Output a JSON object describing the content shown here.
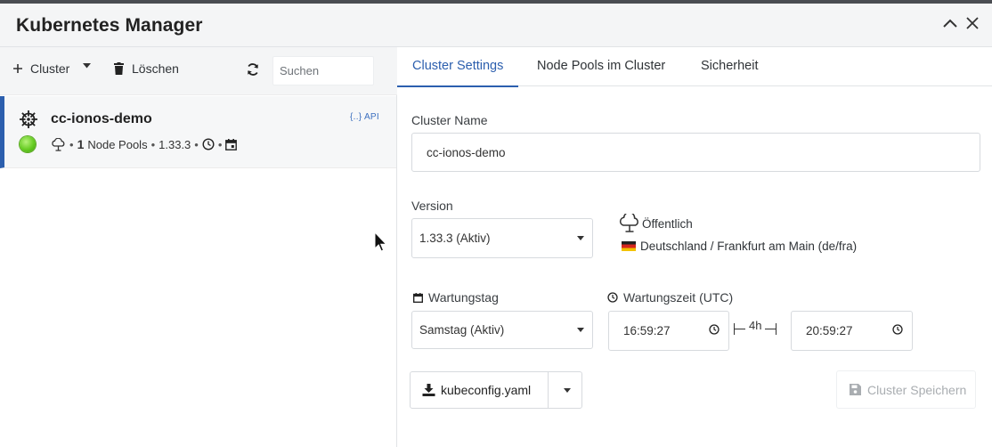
{
  "window": {
    "title": "Kubernetes Manager"
  },
  "toolbar": {
    "add_label": "Cluster",
    "delete_label": "Löschen",
    "search_placeholder": "Suchen"
  },
  "clusters": [
    {
      "name": "cc-ionos-demo",
      "api_badge": "{..} API",
      "status_color": "#66cc22",
      "node_pool_count": "1",
      "node_pools_label": "Node Pools",
      "version": "1.33.3"
    }
  ],
  "tabs": [
    {
      "label": "Cluster Settings",
      "active": true
    },
    {
      "label": "Node Pools im Cluster",
      "active": false
    },
    {
      "label": "Sicherheit",
      "active": false
    }
  ],
  "settings": {
    "cluster_name_label": "Cluster Name",
    "cluster_name_value": "cc-ionos-demo",
    "version_label": "Version",
    "version_value": "1.33.3 (Aktiv)",
    "visibility": "Öffentlich",
    "region": "Deutschland / Frankfurt am Main (de/fra)",
    "maintenance_day_label": "Wartungstag",
    "maintenance_day_value": "Samstag (Aktiv)",
    "maintenance_time_label": "Wartungszeit (UTC)",
    "time_from": "16:59:27",
    "time_to": "20:59:27",
    "duration": "4h"
  },
  "actions": {
    "kubeconfig_label": "kubeconfig.yaml",
    "save_label": "Cluster Speichern"
  },
  "colors": {
    "accent": "#2c5fae",
    "status_ok": "#66cc22"
  }
}
